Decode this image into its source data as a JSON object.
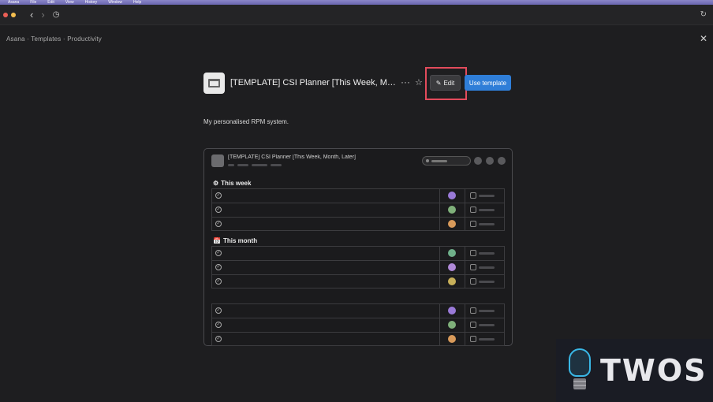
{
  "menubar": {
    "app": "Asana",
    "items": [
      "File",
      "Edit",
      "View",
      "History",
      "Window",
      "Help"
    ]
  },
  "breadcrumb": "Asana · Templates · Productivity",
  "header": {
    "title": "[TEMPLATE] CSI Planner [This Week, Month, ...",
    "more": "···",
    "edit_label": "Edit",
    "use_template_label": "Use template"
  },
  "description": "My personalised RPM system.",
  "preview": {
    "title": "[TEMPLATE] CSI Planner [This Week, Month, Later]",
    "sections": [
      {
        "emoji": "⚙",
        "label": "This week",
        "avatars": [
          "#9a7ad8",
          "#7fb07a",
          "#d89a5a"
        ]
      },
      {
        "emoji": "📅",
        "label": "This month",
        "avatars": [
          "#6fb08a",
          "#b08ad8",
          "#c8b05a"
        ]
      },
      {
        "emoji": "",
        "label": "",
        "avatars": [
          "#9a7ad8",
          "#7fb07a",
          "#d89a5a"
        ]
      }
    ]
  },
  "watermark": {
    "text": "TWOS"
  },
  "colors": {
    "accent": "#2f7ed8",
    "highlight": "#e34b5c",
    "background": "#1e1e20"
  }
}
